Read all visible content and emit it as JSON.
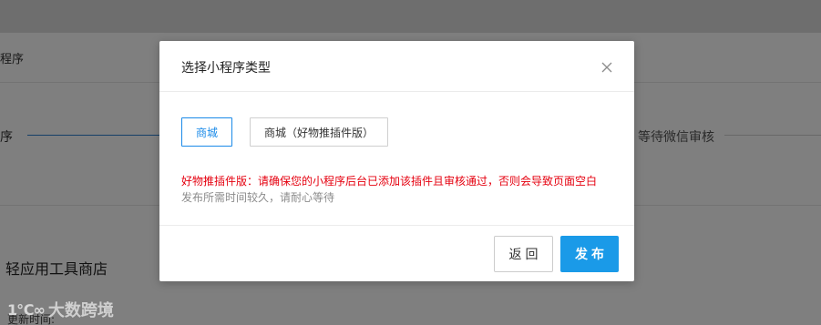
{
  "background": {
    "text_1": "程序",
    "text_2": "序",
    "step_waiting": "等待微信审核",
    "store_heading": "轻应用工具商店",
    "update_time_label": "更新时间:",
    "watermark_logo": "1℃∞",
    "watermark_text": "大数跨境"
  },
  "modal": {
    "title": "选择小程序类型",
    "close_icon": "close-icon",
    "options": [
      {
        "label": "商城",
        "selected": true
      },
      {
        "label": "商城（好物推插件版）",
        "selected": false
      }
    ],
    "note_warning": "好物推插件版：请确保您的小程序后台已添加该插件且审核通过，否则会导致页面空白",
    "note_info": "发布所需时间较久，请耐心等待",
    "back_label": "返回",
    "publish_label": "发布"
  },
  "colors": {
    "accent": "#1a9ae8",
    "selected_border": "#1a8ae8",
    "warning": "#e5000f",
    "overlay": "rgba(0,0,0,0.5)"
  }
}
